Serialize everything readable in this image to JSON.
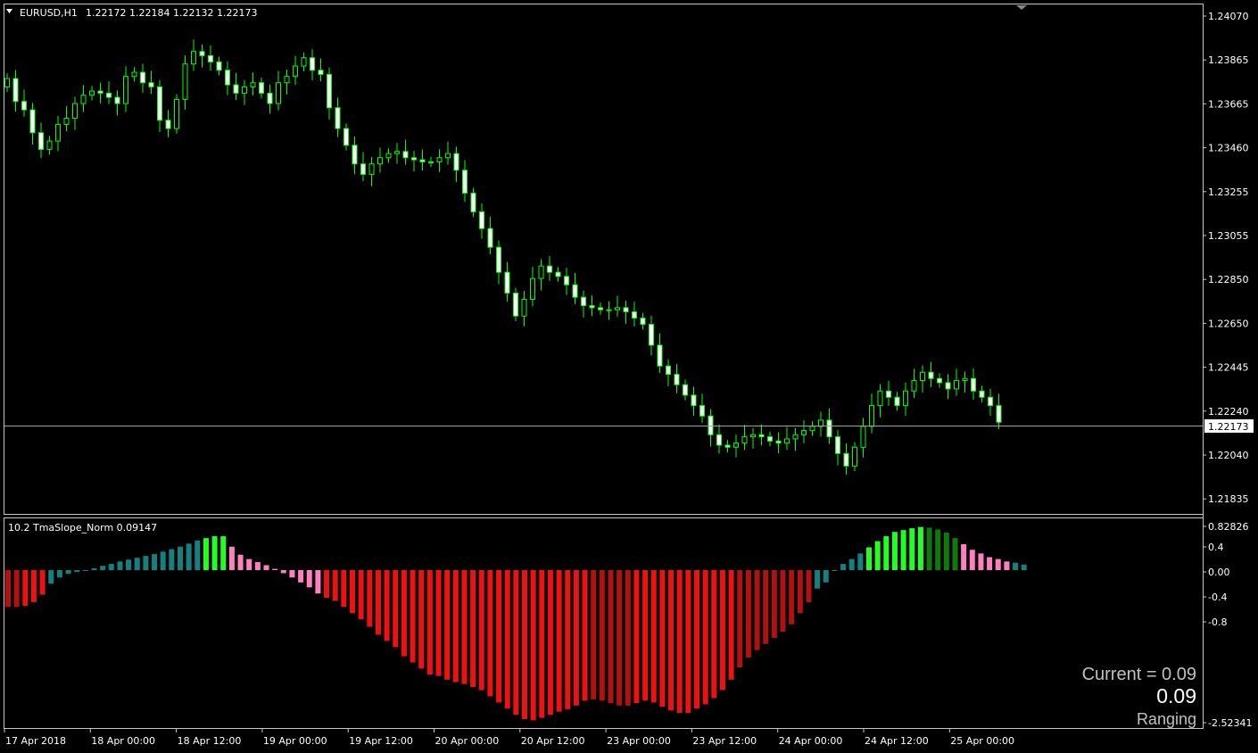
{
  "main_chart": {
    "symbol_label": "EURUSD,H1",
    "ohlc_text": "1.22172 1.22184 1.22132 1.22173",
    "price_ticks": [
      "1.24070",
      "1.23865",
      "1.23665",
      "1.23460",
      "1.23255",
      "1.23055",
      "1.22850",
      "1.22650",
      "1.22445",
      "1.22240",
      "1.22040",
      "1.21835"
    ],
    "current_price": "1.22173",
    "colors": {
      "bull": "#000000",
      "bear": "#ffffff",
      "wick": "#00ff00",
      "border": "#c8c8c8",
      "price_line": "#a0a0a0"
    }
  },
  "indicator": {
    "title": "10.2 TmaSlope_Norm 0.09147",
    "ticks": [
      "0.82826",
      "0.4",
      "0.00",
      "-0.4",
      "-0.8",
      "-2.52341"
    ],
    "colors": {
      "teal": "#158080",
      "bright_green": "#22ff22",
      "dark_green": "#0e7a0e",
      "pink": "#ff80c0",
      "red": "#ee1111",
      "dark_red": "#b01212"
    }
  },
  "time_axis": [
    "17 Apr 2018",
    "18 Apr 00:00",
    "18 Apr 12:00",
    "19 Apr 00:00",
    "19 Apr 12:00",
    "20 Apr 00:00",
    "20 Apr 12:00",
    "23 Apr 00:00",
    "23 Apr 12:00",
    "24 Apr 00:00",
    "24 Apr 12:00",
    "25 Apr 00:00"
  ],
  "status": {
    "current_label": "Current = 0.09",
    "value": "0.09",
    "state": "Ranging"
  },
  "chart_data": [
    {
      "type": "candlestick",
      "title": "EURUSD,H1",
      "xlabel": "",
      "ylabel": "",
      "ylim": [
        1.2173,
        1.2418
      ],
      "close_path": [
        1.2382,
        1.2371,
        1.2367,
        1.2356,
        1.2348,
        1.2352,
        1.236,
        1.2363,
        1.237,
        1.2374,
        1.2376,
        1.2375,
        1.2373,
        1.237,
        1.2383,
        1.2385,
        1.238,
        1.2378,
        1.2362,
        1.2358,
        1.2372,
        1.2389,
        1.2395,
        1.2393,
        1.239,
        1.2386,
        1.2379,
        1.2375,
        1.2378,
        1.238,
        1.2375,
        1.237,
        1.238,
        1.2383,
        1.2388,
        1.2392,
        1.2386,
        1.2384,
        1.2368,
        1.2358,
        1.235,
        1.2341,
        1.2336,
        1.2341,
        1.2344,
        1.2346,
        1.2347,
        1.2344,
        1.2343,
        1.2342,
        1.2342,
        1.2344,
        1.2346,
        1.2338,
        1.2327,
        1.2318,
        1.231,
        1.2301,
        1.2289,
        1.2279,
        1.2268,
        1.2276,
        1.2286,
        1.2292,
        1.2289,
        1.2287,
        1.2283,
        1.2277,
        1.2273,
        1.2272,
        1.2271,
        1.2271,
        1.2272,
        1.227,
        1.2267,
        1.2264,
        1.2254,
        1.2244,
        1.224,
        1.2235,
        1.223,
        1.2225,
        1.222,
        1.2211,
        1.2206,
        1.2205,
        1.2207,
        1.221,
        1.2211,
        1.221,
        1.2208,
        1.2207,
        1.2209,
        1.2211,
        1.2213,
        1.2215,
        1.2218,
        1.221,
        1.2202,
        1.2196,
        1.2205,
        1.2215,
        1.2225,
        1.2232,
        1.2229,
        1.2225,
        1.2232,
        1.2237,
        1.2241,
        1.2238,
        1.2236,
        1.2233,
        1.2237,
        1.2238,
        1.2232,
        1.2229,
        1.2225,
        1.2217
      ]
    },
    {
      "type": "bar",
      "title": "10.2 TmaSlope_Norm 0.09147",
      "xlabel": "",
      "ylabel": "",
      "ylim": [
        -2.52341,
        0.82826
      ],
      "values": [
        -0.6,
        -0.6,
        -0.58,
        -0.52,
        -0.4,
        -0.22,
        -0.12,
        -0.06,
        -0.03,
        0.0,
        0.03,
        0.07,
        0.1,
        0.14,
        0.17,
        0.2,
        0.23,
        0.26,
        0.3,
        0.34,
        0.38,
        0.43,
        0.48,
        0.52,
        0.55,
        0.55,
        0.38,
        0.25,
        0.18,
        0.13,
        0.08,
        0.02,
        -0.05,
        -0.12,
        -0.2,
        -0.28,
        -0.38,
        -0.45,
        -0.5,
        -0.6,
        -0.7,
        -0.8,
        -0.92,
        -1.05,
        -1.15,
        -1.25,
        -1.4,
        -1.5,
        -1.6,
        -1.7,
        -1.72,
        -1.78,
        -1.82,
        -1.85,
        -1.9,
        -1.95,
        -2.05,
        -2.15,
        -2.25,
        -2.35,
        -2.42,
        -2.44,
        -2.4,
        -2.35,
        -2.3,
        -2.26,
        -2.2,
        -2.12,
        -2.1,
        -2.12,
        -2.16,
        -2.2,
        -2.2,
        -2.16,
        -2.12,
        -2.15,
        -2.22,
        -2.28,
        -2.32,
        -2.32,
        -2.25,
        -2.18,
        -2.08,
        -1.95,
        -1.78,
        -1.58,
        -1.42,
        -1.3,
        -1.2,
        -1.1,
        -1.0,
        -0.88,
        -0.7,
        -0.52,
        -0.3,
        -0.2,
        0.0,
        0.1,
        0.18,
        0.27,
        0.37,
        0.47,
        0.55,
        0.62,
        0.65,
        0.68,
        0.7,
        0.69,
        0.66,
        0.61,
        0.52,
        0.42,
        0.33,
        0.27,
        0.21,
        0.18,
        0.14,
        0.12,
        0.09
      ],
      "colors": [
        "dark_red",
        "dark_red",
        "red",
        "red",
        "red",
        "teal",
        "teal",
        "teal",
        "teal",
        "teal",
        "teal",
        "teal",
        "teal",
        "teal",
        "teal",
        "teal",
        "teal",
        "teal",
        "teal",
        "teal",
        "teal",
        "teal",
        "teal",
        "bright_green",
        "bright_green",
        "bright_green",
        "pink",
        "pink",
        "pink",
        "pink",
        "pink",
        "pink",
        "pink",
        "pink",
        "pink",
        "pink",
        "pink",
        "red",
        "red",
        "red",
        "red",
        "red",
        "red",
        "red",
        "red",
        "red",
        "red",
        "red",
        "red",
        "red",
        "red",
        "red",
        "red",
        "red",
        "red",
        "red",
        "red",
        "red",
        "red",
        "red",
        "red",
        "red",
        "red",
        "red",
        "red",
        "red",
        "red",
        "red",
        "dark_red",
        "dark_red",
        "dark_red",
        "dark_red",
        "dark_red",
        "red",
        "red",
        "red",
        "red",
        "red",
        "red",
        "red",
        "red",
        "red",
        "red",
        "red",
        "red",
        "dark_red",
        "dark_red",
        "dark_red",
        "dark_red",
        "dark_red",
        "dark_red",
        "dark_red",
        "dark_red",
        "dark_red",
        "teal",
        "teal",
        "teal",
        "teal",
        "teal",
        "teal",
        "bright_green",
        "bright_green",
        "bright_green",
        "bright_green",
        "bright_green",
        "bright_green",
        "bright_green",
        "dark_green",
        "dark_green",
        "dark_green",
        "dark_green",
        "pink",
        "pink",
        "pink",
        "pink",
        "pink",
        "pink",
        "teal",
        "teal",
        "pink"
      ]
    }
  ]
}
